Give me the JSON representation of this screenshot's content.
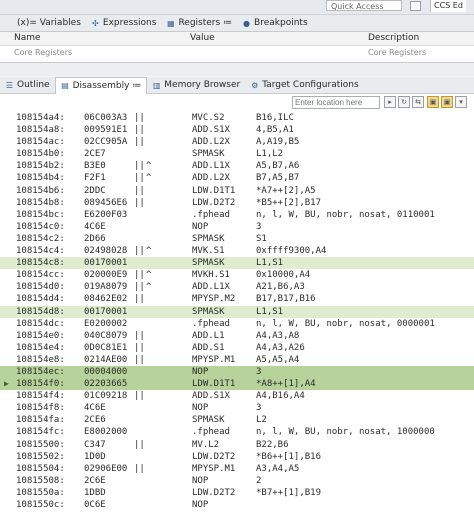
{
  "toolbar": {
    "quick_access": "Quick Access",
    "perspective": "CCS Ed"
  },
  "top_tabs": [
    {
      "label": "(x)= Variables",
      "icon": "variables-icon",
      "active": false
    },
    {
      "label": "Expressions",
      "icon": "expressions-icon",
      "active": false
    },
    {
      "label": "Registers ≔",
      "icon": "registers-icon",
      "active": false
    },
    {
      "label": "Breakpoints",
      "icon": "breakpoints-icon",
      "active": false
    }
  ],
  "variables": {
    "col_name": "Name",
    "col_value": "Value",
    "col_description": "Description",
    "row_name": "Core Registers",
    "row_description": "Core Registers"
  },
  "mid_tabs": [
    {
      "label": "Outline",
      "icon": "outline-icon",
      "active": false
    },
    {
      "label": "Disassembly ≔",
      "icon": "disassembly-icon",
      "active": true
    },
    {
      "label": "Memory Browser",
      "icon": "memory-icon",
      "active": false
    },
    {
      "label": "Target Configurations",
      "icon": "target-config-icon",
      "active": false
    }
  ],
  "location": {
    "placeholder": "Enter location here"
  },
  "disassembly": [
    {
      "addr": "108154a4:",
      "op": "06C003A3",
      "par": "||",
      "car": "",
      "mn": "MVC.S2",
      "args": "B16,ILC",
      "hl": ""
    },
    {
      "addr": "108154a8:",
      "op": "009591E1",
      "par": "||",
      "car": "",
      "mn": "ADD.S1X",
      "args": "4,B5,A1",
      "hl": ""
    },
    {
      "addr": "108154ac:",
      "op": "02CC905A",
      "par": "||",
      "car": "",
      "mn": "ADD.L2X",
      "args": "A,A19,B5",
      "hl": ""
    },
    {
      "addr": "108154b0:",
      "op": "2CE7",
      "par": "",
      "car": "",
      "mn": "SPMASK",
      "args": "L1,L2",
      "hl": ""
    },
    {
      "addr": "108154b2:",
      "op": "B3E0",
      "par": "||",
      "car": "^",
      "mn": "ADD.L1X",
      "args": "A5,B7,A6",
      "hl": ""
    },
    {
      "addr": "108154b4:",
      "op": "F2F1",
      "par": "||",
      "car": "^",
      "mn": "ADD.L2X",
      "args": "B7,A5,B7",
      "hl": ""
    },
    {
      "addr": "108154b6:",
      "op": "2DDC",
      "par": "||",
      "car": "",
      "mn": "LDW.D1T1",
      "args": "*A7++[2],A5",
      "hl": ""
    },
    {
      "addr": "108154b8:",
      "op": "089456E6",
      "par": "||",
      "car": "",
      "mn": "LDW.D2T2",
      "args": "*B5++[2],B17",
      "hl": ""
    },
    {
      "addr": "108154bc:",
      "op": "E6200F03",
      "par": "",
      "car": "",
      "mn": ".fphead",
      "args": "n, l, W, BU, nobr, nosat, 0110001",
      "hl": ""
    },
    {
      "addr": "108154c0:",
      "op": "4C6E",
      "par": "",
      "car": "",
      "mn": "NOP",
      "args": "3",
      "hl": ""
    },
    {
      "addr": "108154c2:",
      "op": "2D66",
      "par": "",
      "car": "",
      "mn": "SPMASK",
      "args": "S1",
      "hl": ""
    },
    {
      "addr": "108154c4:",
      "op": "02498028",
      "par": "||",
      "car": "^",
      "mn": "MVK.S1",
      "args": "0xffff9300,A4",
      "hl": ""
    },
    {
      "addr": "108154c8:",
      "op": "00170001",
      "par": "",
      "car": "",
      "mn": "SPMASK",
      "args": "L1,S1",
      "hl": "g"
    },
    {
      "addr": "108154cc:",
      "op": "020000E9",
      "par": "||",
      "car": "^",
      "mn": "MVKH.S1",
      "args": "0x10000,A4",
      "hl": ""
    },
    {
      "addr": "108154d0:",
      "op": "019A8079",
      "par": "||",
      "car": "^",
      "mn": "ADD.L1X",
      "args": "A21,B6,A3",
      "hl": ""
    },
    {
      "addr": "108154d4:",
      "op": "08462E02",
      "par": "||",
      "car": "",
      "mn": "MPYSP.M2",
      "args": "B17,B17,B16",
      "hl": ""
    },
    {
      "addr": "108154d8:",
      "op": "00170001",
      "par": "",
      "car": "",
      "mn": "SPMASK",
      "args": "L1,S1",
      "hl": "g"
    },
    {
      "addr": "108154dc:",
      "op": "E0200002",
      "par": "",
      "car": "",
      "mn": ".fphead",
      "args": "n, l, W, BU, nobr, nosat, 0000001",
      "hl": ""
    },
    {
      "addr": "108154e0:",
      "op": "040C8079",
      "par": "||",
      "car": "",
      "mn": "ADD.L1",
      "args": "A4,A3,A8",
      "hl": ""
    },
    {
      "addr": "108154e4:",
      "op": "0D0C81E1",
      "par": "||",
      "car": "",
      "mn": "ADD.S1",
      "args": "A4,A3,A26",
      "hl": ""
    },
    {
      "addr": "108154e8:",
      "op": "0214AE00",
      "par": "||",
      "car": "",
      "mn": "MPYSP.M1",
      "args": "A5,A5,A4",
      "hl": ""
    },
    {
      "addr": "108154ec:",
      "op": "00004000",
      "par": "",
      "car": "",
      "mn": "NOP",
      "args": "3",
      "hl": "s"
    },
    {
      "addr": "108154f0:",
      "op": "02203665",
      "par": "",
      "car": "",
      "mn": "LDW.D1T1",
      "args": "*A8++[1],A4",
      "hl": "s",
      "pc": true
    },
    {
      "addr": "108154f4:",
      "op": "01C09218",
      "par": "||",
      "car": "",
      "mn": "ADD.S1X",
      "args": "A4,B16,A4",
      "hl": ""
    },
    {
      "addr": "108154f8:",
      "op": "4C6E",
      "par": "",
      "car": "",
      "mn": "NOP",
      "args": "3",
      "hl": ""
    },
    {
      "addr": "108154fa:",
      "op": "2CE6",
      "par": "",
      "car": "",
      "mn": "SPMASK",
      "args": "L2",
      "hl": ""
    },
    {
      "addr": "108154fc:",
      "op": "E8002000",
      "par": "",
      "car": "",
      "mn": ".fphead",
      "args": "n, l, W, BU, nobr, nosat, 1000000",
      "hl": ""
    },
    {
      "addr": "10815500:",
      "op": "C347",
      "par": "||",
      "car": "",
      "mn": "MV.L2",
      "args": "B22,B6",
      "hl": ""
    },
    {
      "addr": "10815502:",
      "op": "1D0D",
      "par": "",
      "car": "",
      "mn": "LDW.D2T2",
      "args": "*B6++[1],B16",
      "hl": ""
    },
    {
      "addr": "10815504:",
      "op": "02906E00",
      "par": "||",
      "car": "",
      "mn": "MPYSP.M1",
      "args": "A3,A4,A5",
      "hl": ""
    },
    {
      "addr": "10815508:",
      "op": "2C6E",
      "par": "",
      "car": "",
      "mn": "NOP",
      "args": "2",
      "hl": ""
    },
    {
      "addr": "1081550a:",
      "op": "1DBD",
      "par": "",
      "car": "",
      "mn": "LDW.D2T2",
      "args": "*B7++[1],B19",
      "hl": ""
    },
    {
      "addr": "1081550c:",
      "op": "0C6E",
      "par": "",
      "car": "",
      "mn": "NOP",
      "args": "",
      "hl": ""
    }
  ]
}
